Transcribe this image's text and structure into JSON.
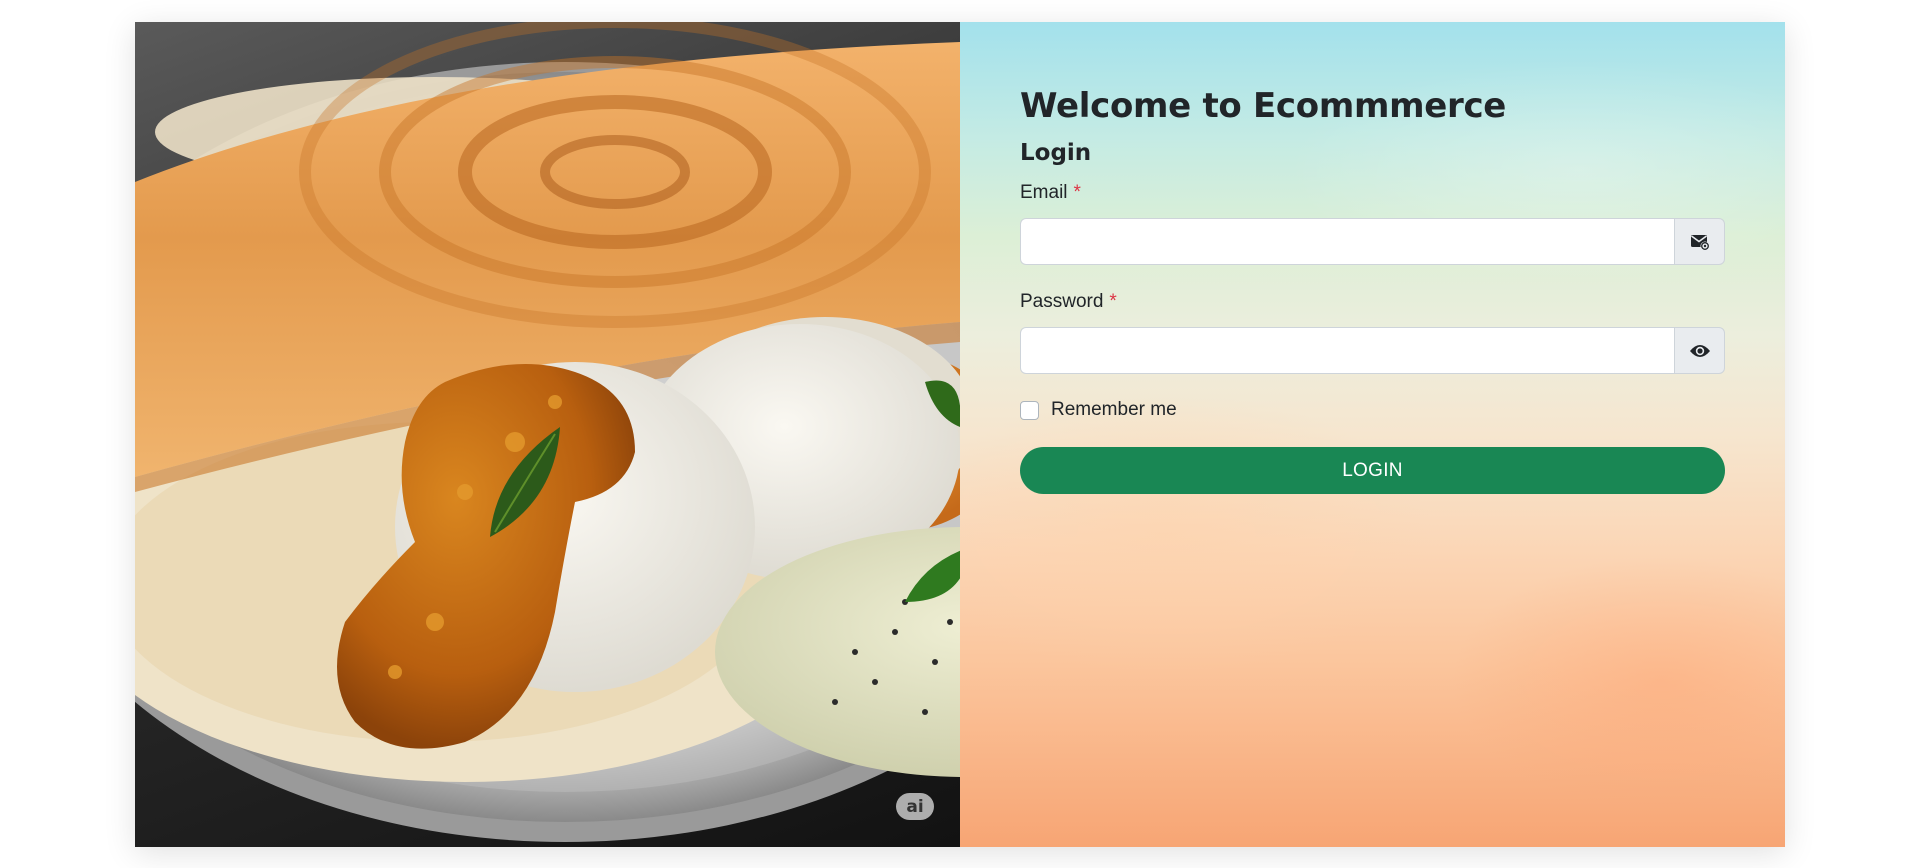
{
  "image": {
    "badge": "ai"
  },
  "form": {
    "title": "Welcome to Ecommmerce",
    "subtitle": "Login",
    "email": {
      "label": "Email",
      "required_mark": "*",
      "value": "",
      "icon": "envelope-at-icon"
    },
    "password": {
      "label": "Password",
      "required_mark": "*",
      "value": "",
      "icon": "eye-icon"
    },
    "remember": {
      "label": "Remember me",
      "checked": false
    },
    "submit_label": "LOGIN"
  },
  "colors": {
    "primary_button": "#198754",
    "required": "#dc3545",
    "text": "#212529"
  }
}
